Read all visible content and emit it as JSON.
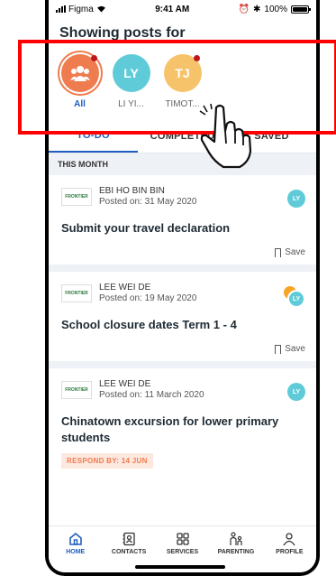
{
  "status": {
    "carrier": "Figma",
    "time": "9:41 AM",
    "battery": "100%"
  },
  "header": {
    "title": "Showing posts for",
    "filters": [
      {
        "label": "All",
        "initials": "",
        "has_dot": true,
        "selected": true
      },
      {
        "label": "LI YI...",
        "initials": "LY",
        "has_dot": false,
        "selected": false
      },
      {
        "label": "TIMOT...",
        "initials": "TJ",
        "has_dot": true,
        "selected": false
      }
    ]
  },
  "tabs": [
    {
      "label": "TO-DO",
      "active": true
    },
    {
      "label": "COMPLETED",
      "active": false
    },
    {
      "label": "SAVED",
      "active": false
    }
  ],
  "section_label": "THIS MONTH",
  "posts": [
    {
      "author": "EBI HO BIN BIN",
      "posted": "Posted on: 31 May 2020",
      "title": "Submit your travel declaration",
      "target_initials": "LY",
      "save_label": "Save",
      "logo_text": "FRONTIER"
    },
    {
      "author": "LEE WEI DE",
      "posted": "Posted on: 19 May 2020",
      "title": "School closure dates Term 1 - 4",
      "target_initials": "LY",
      "save_label": "Save",
      "logo_text": "FRONTIER"
    },
    {
      "author": "LEE WEI DE",
      "posted": "Posted on: 11 March 2020",
      "title": "Chinatown excursion for lower primary students",
      "target_initials": "LY",
      "respond_by": "RESPOND BY: 14 JUN",
      "logo_text": "FRONTIER"
    }
  ],
  "nav": [
    {
      "label": "HOME",
      "icon": "home-icon",
      "active": true
    },
    {
      "label": "CONTACTS",
      "icon": "contacts-icon",
      "active": false
    },
    {
      "label": "SERVICES",
      "icon": "services-icon",
      "active": false
    },
    {
      "label": "PARENTING",
      "icon": "parenting-icon",
      "active": false
    },
    {
      "label": "PROFILE",
      "icon": "profile-icon",
      "active": false
    }
  ],
  "colors": {
    "accent": "#1f5fbf",
    "orange": "#ef7c4f",
    "teal": "#5fcbd8",
    "yellow": "#f6c36a",
    "highlight": "#ff0000"
  }
}
